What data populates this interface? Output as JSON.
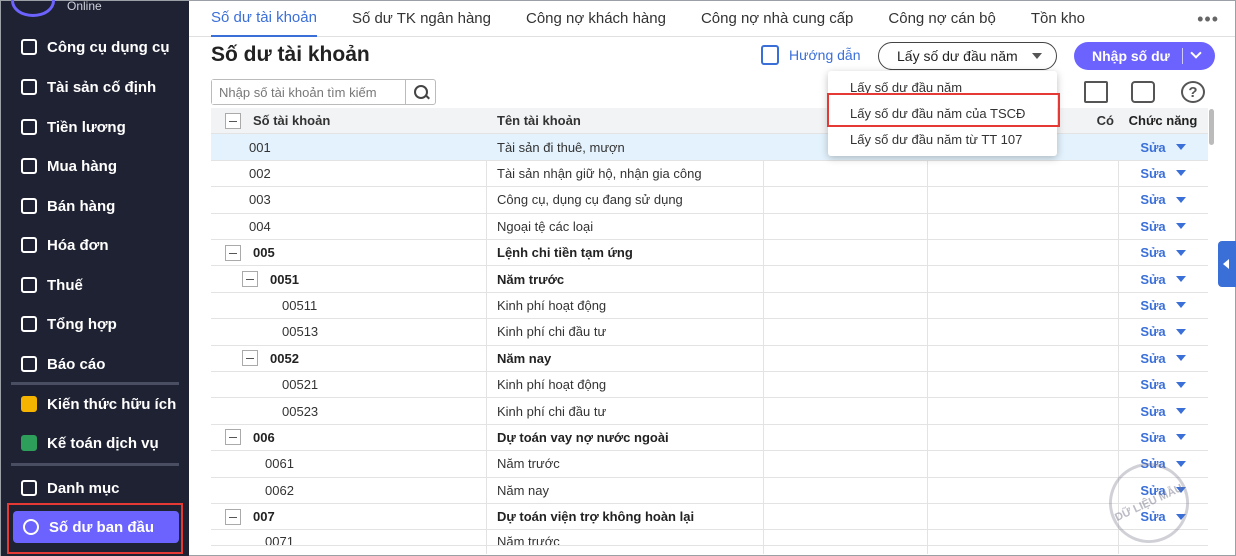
{
  "sidebar": {
    "logo_text": "Online",
    "items": [
      {
        "label": "Công cụ dụng cụ"
      },
      {
        "label": "Tài sản cố định"
      },
      {
        "label": "Tiền lương"
      },
      {
        "label": "Mua hàng"
      },
      {
        "label": "Bán hàng"
      },
      {
        "label": "Hóa đơn"
      },
      {
        "label": "Thuế"
      },
      {
        "label": "Tổng hợp"
      },
      {
        "label": "Báo cáo"
      },
      {
        "label": "Kiến thức hữu ích"
      },
      {
        "label": "Kế toán dịch vụ"
      },
      {
        "label": "Danh mục"
      },
      {
        "label": "Số dư ban đầu"
      }
    ]
  },
  "tabs": [
    {
      "label": "Số dư tài khoản"
    },
    {
      "label": "Số dư TK ngân hàng"
    },
    {
      "label": "Công nợ khách hàng"
    },
    {
      "label": "Công nợ nhà cung cấp"
    },
    {
      "label": "Công nợ cán bộ"
    },
    {
      "label": "Tồn kho"
    }
  ],
  "tabs_more": "•••",
  "page_title": "Số dư tài khoản",
  "guide_label": "Hướng dẫn",
  "fetch_button": "Lấy số dư đầu năm",
  "import_button": "Nhập số dư",
  "search_placeholder": "Nhập số tài khoản tìm kiếm",
  "help_symbol": "?",
  "dropdown": [
    {
      "label": "Lấy số dư đầu năm"
    },
    {
      "label": "Lấy số dư đầu năm của TSCĐ"
    },
    {
      "label": "Lấy số dư đầu năm từ TT 107"
    }
  ],
  "table": {
    "headers": {
      "account": "Số tài khoản",
      "name": "Tên tài khoản",
      "credit_partial": "Có",
      "func": "Chức năng"
    },
    "edit_label": "Sửa",
    "rows": [
      {
        "acc": "001",
        "name": "Tài sản đi thuê, mượn"
      },
      {
        "acc": "002",
        "name": "Tài sản nhận giữ hộ, nhận gia công"
      },
      {
        "acc": "003",
        "name": "Công cụ, dụng cụ đang sử dụng"
      },
      {
        "acc": "004",
        "name": "Ngoại tệ các loại"
      },
      {
        "acc": "005",
        "name": "Lệnh chi tiền tạm ứng"
      },
      {
        "acc": "0051",
        "name": "Năm trước"
      },
      {
        "acc": "00511",
        "name": "Kinh phí hoạt động"
      },
      {
        "acc": "00513",
        "name": "Kinh phí chi đầu tư"
      },
      {
        "acc": "0052",
        "name": "Năm nay"
      },
      {
        "acc": "00521",
        "name": "Kinh phí hoạt động"
      },
      {
        "acc": "00523",
        "name": "Kinh phí chi đầu tư"
      },
      {
        "acc": "006",
        "name": "Dự toán vay nợ nước ngoài"
      },
      {
        "acc": "0061",
        "name": "Năm trước"
      },
      {
        "acc": "0062",
        "name": "Năm nay"
      },
      {
        "acc": "007",
        "name": "Dự toán viện trợ không hoàn lại"
      },
      {
        "acc": "0071",
        "name": "Năm trước"
      }
    ]
  },
  "stamp_text": "DỮ LIỆU MẪU",
  "colors": {
    "primary": "#6c63ff",
    "link": "#3b6fd8",
    "highlight": "#e53935",
    "sidebar": "#1f2233"
  }
}
